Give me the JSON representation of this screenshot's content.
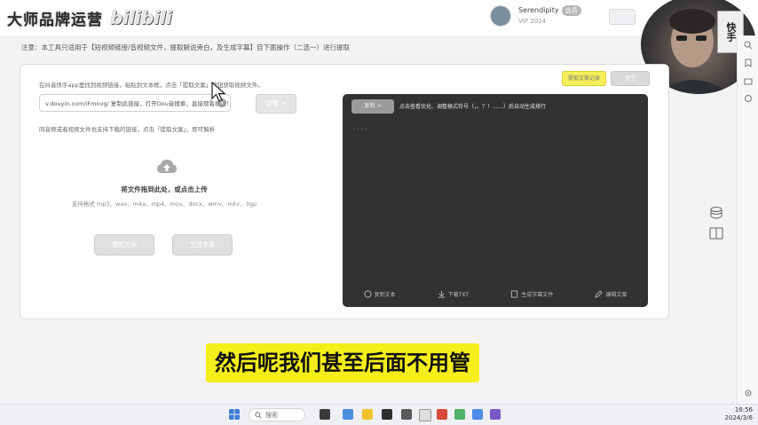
{
  "header": {
    "logo_text": "大师品牌运营",
    "logo_bili": "bilibili",
    "user_name": "Serendipity",
    "user_badge": "会员",
    "user_sub": "VIP 2024"
  },
  "webcam": {
    "sign_text": "快手"
  },
  "notice": "注意：本工具只适用于【短视频链接/音视频文件，提取解说旁白，及生成字幕】目下面操作（二选一）进行提取",
  "left": {
    "hint1": "在抖音快手app里找到视频链接，粘贴到文本框，点击「提取文案」按钮获取视频文件。",
    "url_value": "v.douyin.com/iFmnvg/ 复制此链接，打开Dou音搜索，直接观看视频！",
    "url_clear": "×",
    "extract_label": "提取 >",
    "hint2": "同音频或者视频文件也支持下载的链接，点击「提取文案」，即可解析",
    "upload_main": "将文件拖到此处，或点击上传",
    "upload_formats": "支持格式 mp3、wav、m4a、mp4、mov、docx、wmv、mkv、3gp",
    "btn_a": "提取文案",
    "btn_b": "生成字幕"
  },
  "right": {
    "yellow_btn": "提取文案记录",
    "gray_btn": "清空",
    "dark_btn": "复制 >",
    "dark_hint": "点击查看优化、调整格式符号（，。？！……）后自动生成排行",
    "dark_dots": "· · · ·",
    "footer": [
      "复制文本",
      "下载TXT",
      "生成字幕文件",
      "编辑文案"
    ]
  },
  "subtitle": "然后呢我们甚至后面不用管",
  "taskbar": {
    "search_label": "搜索",
    "time": "16:56",
    "date": "2024/3/6"
  },
  "colors": {
    "subtitle_bg": "#f6ee1a",
    "dark_panel": "#323232",
    "accent_yellow": "#f4ee5a"
  }
}
